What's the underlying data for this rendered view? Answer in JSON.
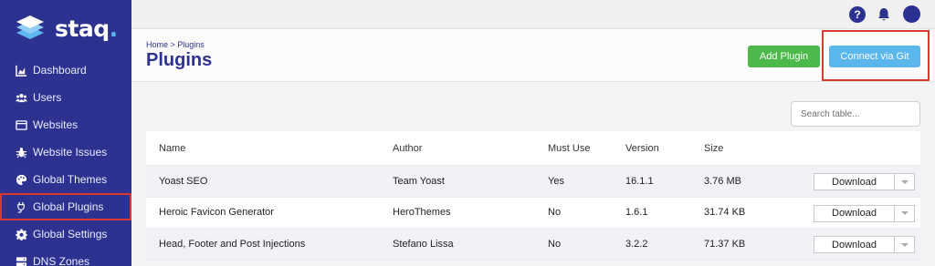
{
  "brand": {
    "name": "staq",
    "dot": ".",
    "color": "#2d3291",
    "accent": "#5fb7ef"
  },
  "sidebar": {
    "items": [
      {
        "label": "Dashboard",
        "icon": "chart-area-icon"
      },
      {
        "label": "Users",
        "icon": "users-icon"
      },
      {
        "label": "Websites",
        "icon": "browser-window-icon"
      },
      {
        "label": "Website Issues",
        "icon": "bug-icon"
      },
      {
        "label": "Global Themes",
        "icon": "palette-icon"
      },
      {
        "label": "Global Plugins",
        "icon": "plug-icon",
        "active": true
      },
      {
        "label": "Global Settings",
        "icon": "gear-icon"
      },
      {
        "label": "DNS Zones",
        "icon": "server-icon"
      }
    ]
  },
  "topbar": {
    "help_label": "?",
    "icons": [
      "question-circle-icon",
      "bell-icon",
      "avatar"
    ]
  },
  "header": {
    "breadcrumb": "Home > Plugins",
    "title": "Plugins",
    "add_button": "Add Plugin",
    "git_button": "Connect via Git"
  },
  "search": {
    "placeholder": "Search table..."
  },
  "table": {
    "columns": [
      "Name",
      "Author",
      "Must Use",
      "Version",
      "Size"
    ],
    "rows": [
      {
        "name": "Yoast SEO",
        "author": "Team Yoast",
        "must_use": "Yes",
        "version": "16.1.1",
        "size": "3.76 MB",
        "action": "Download"
      },
      {
        "name": "Heroic Favicon Generator",
        "author": "HeroThemes",
        "must_use": "No",
        "version": "1.6.1",
        "size": "31.74 KB",
        "action": "Download"
      },
      {
        "name": "Head, Footer and Post Injections",
        "author": "Stefano Lissa",
        "must_use": "No",
        "version": "3.2.2",
        "size": "71.37 KB",
        "action": "Download"
      }
    ]
  }
}
